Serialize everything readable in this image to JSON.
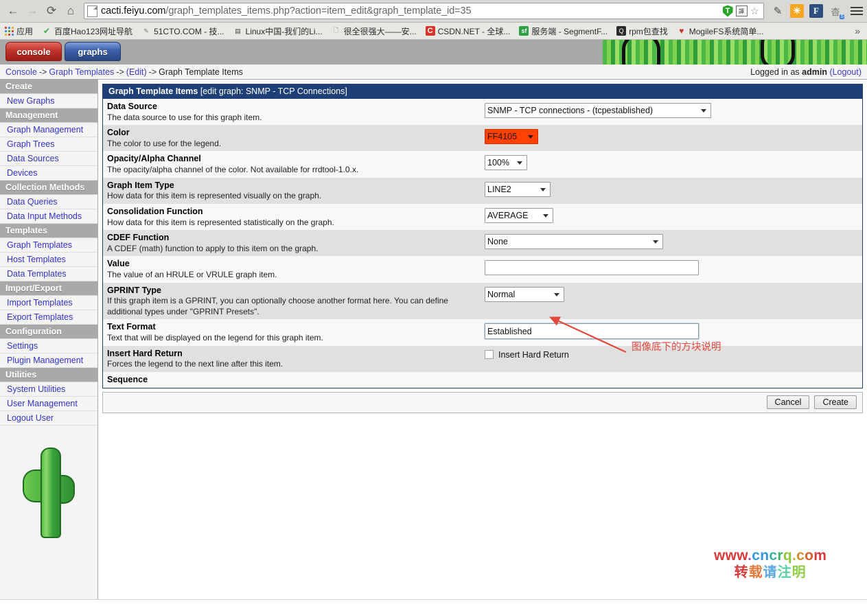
{
  "browser": {
    "back_icon": "←",
    "forward_icon": "→",
    "reload_icon": "⟳",
    "home_icon": "⌂",
    "url_host": "cacti.feiyu.com",
    "url_path": "/graph_templates_items.php?action=item_edit&graph_template_id=35",
    "shield_letter": "T",
    "translate_letter": "譯",
    "star_icon": "☆",
    "ext_note_icon": "✎",
    "ext_orange_icon": "✳",
    "ext_f_icon": "F",
    "ext_cn_icon": "杳",
    "bookmarks": [
      {
        "label": "应用",
        "icon": "apps-grid"
      },
      {
        "label": "百度Hao123网址导航",
        "icon": "hao-icon",
        "glyph": "✔"
      },
      {
        "label": "51CTO.COM - 技...",
        "icon": "pen-icon",
        "glyph": "✎"
      },
      {
        "label": "Linux中国-我们的Li...",
        "icon": "book-icon",
        "glyph": "▤"
      },
      {
        "label": "很全很强大——安...",
        "icon": "page-icon",
        "glyph": "🗋"
      },
      {
        "label": "CSDN.NET - 全球...",
        "icon": "csdn-icon",
        "glyph": "C"
      },
      {
        "label": "服务端 - SegmentF...",
        "icon": "segmentfault-icon",
        "glyph": "sf"
      },
      {
        "label": "rpm包查找",
        "icon": "search-icon",
        "glyph": "🔍"
      },
      {
        "label": "MogileFS系统简单...",
        "icon": "shield-icon",
        "glyph": "♥"
      }
    ],
    "overflow_icon": "»"
  },
  "app": {
    "tabs": [
      {
        "label": "console",
        "name": "tab-console",
        "active": false
      },
      {
        "label": "graphs",
        "name": "tab-graphs",
        "active": true
      }
    ],
    "breadcrumb": {
      "items": [
        "Console",
        "Graph Templates",
        "(Edit)",
        "Graph Template Items"
      ],
      "separator": "->"
    },
    "login": {
      "prefix": "Logged in as ",
      "user": "admin",
      "logout_label": "(Logout)"
    }
  },
  "sidebar": {
    "groups": [
      {
        "header": "Create",
        "items": [
          "New Graphs"
        ]
      },
      {
        "header": "Management",
        "items": [
          "Graph Management",
          "Graph Trees",
          "Data Sources",
          "Devices"
        ]
      },
      {
        "header": "Collection Methods",
        "items": [
          "Data Queries",
          "Data Input Methods"
        ]
      },
      {
        "header": "Templates",
        "items": [
          "Graph Templates",
          "Host Templates",
          "Data Templates"
        ]
      },
      {
        "header": "Import/Export",
        "items": [
          "Import Templates",
          "Export Templates"
        ]
      },
      {
        "header": "Configuration",
        "items": [
          "Settings",
          "Plugin Management"
        ]
      },
      {
        "header": "Utilities",
        "items": [
          "System Utilities",
          "User Management",
          "Logout User"
        ]
      }
    ]
  },
  "panel": {
    "title_bold": "Graph Template Items",
    "title_sub": " [edit graph: SNMP - TCP Connections]"
  },
  "form": {
    "rows": [
      {
        "label": "Data Source",
        "desc": "The data source to use for this graph item.",
        "control": "select",
        "value": "SNMP - TCP connections - (tcpestablished)"
      },
      {
        "label": "Color",
        "desc": "The color to use for the legend.",
        "control": "color-select",
        "value": "FF4105",
        "swatch_hex": "#FF4105"
      },
      {
        "label": "Opacity/Alpha Channel",
        "desc": "The opacity/alpha channel of the color. Not available for rrdtool-1.0.x.",
        "control": "select",
        "value": "100%"
      },
      {
        "label": "Graph Item Type",
        "desc": "How data for this item is represented visually on the graph.",
        "control": "select",
        "value": "LINE2"
      },
      {
        "label": "Consolidation Function",
        "desc": "How data for this item is represented statistically on the graph.",
        "control": "select",
        "value": "AVERAGE"
      },
      {
        "label": "CDEF Function",
        "desc": "A CDEF (math) function to apply to this item on the graph.",
        "control": "select",
        "value": "None"
      },
      {
        "label": "Value",
        "desc": "The value of an HRULE or VRULE graph item.",
        "control": "text",
        "value": ""
      },
      {
        "label": "GPRINT Type",
        "desc": "If this graph item is a GPRINT, you can optionally choose another format here. You can define additional types under \"GPRINT Presets\".",
        "control": "select",
        "value": "Normal"
      },
      {
        "label": "Text Format",
        "desc": "Text that will be displayed on the legend for this graph item.",
        "control": "text-focused",
        "value": "Established"
      },
      {
        "label": "Insert Hard Return",
        "desc": "Forces the legend to the next line after this item.",
        "control": "checkbox",
        "checkbox_label": "Insert Hard Return",
        "checked": false
      }
    ],
    "sequence_label": "Sequence",
    "buttons": {
      "cancel": "Cancel",
      "create": "Create"
    }
  },
  "annotation": {
    "text": "图像底下的方块说明",
    "color": "#e2483c"
  },
  "watermark": {
    "line1": "www.cncrq.com",
    "line2": "转载请注明",
    "line1_colors": [
      "#d93b3b",
      "#d93b3b",
      "#d93b3b",
      "#9b59b6",
      "#3498db",
      "#3498db",
      "#3bb2a8",
      "#3bb26a",
      "#8fc43b",
      "#c8b534",
      "#d98b2b",
      "#d95f2b",
      "#d93b3b"
    ],
    "line2_colors": [
      "#d93b3b",
      "#e07b3b",
      "#5aa8e0",
      "#5ad0a0",
      "#8fd04a"
    ]
  }
}
